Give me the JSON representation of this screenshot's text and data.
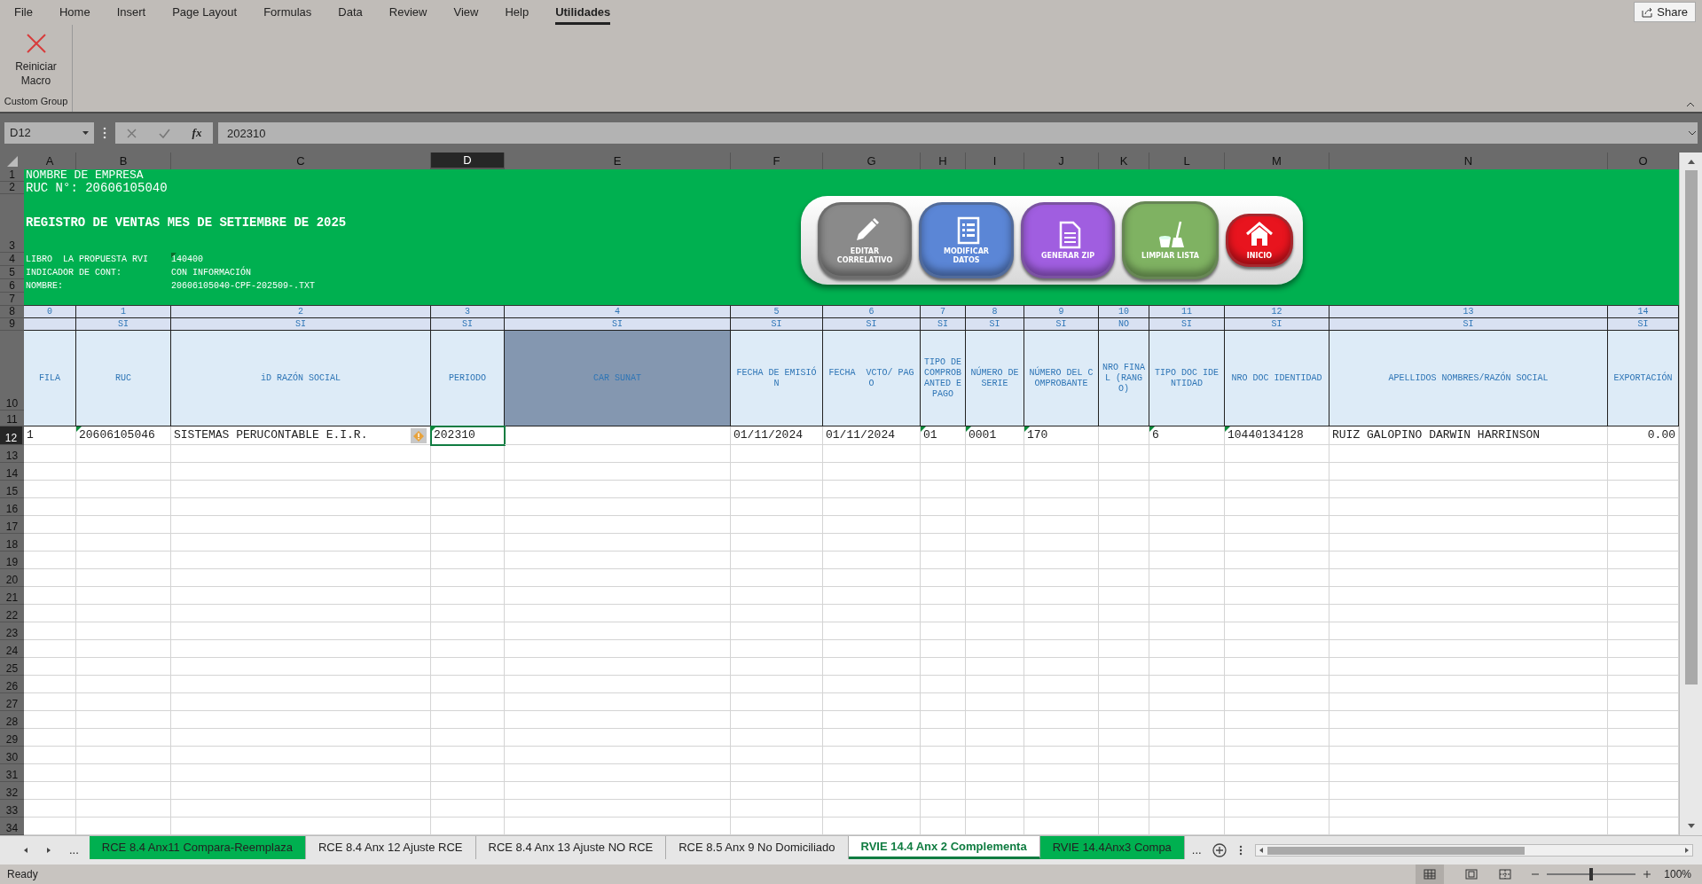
{
  "menu_tabs": [
    {
      "label": "File",
      "selected": false
    },
    {
      "label": "Home",
      "selected": false
    },
    {
      "label": "Insert",
      "selected": false
    },
    {
      "label": "Page Layout",
      "selected": false
    },
    {
      "label": "Formulas",
      "selected": false
    },
    {
      "label": "Data",
      "selected": false
    },
    {
      "label": "Review",
      "selected": false
    },
    {
      "label": "View",
      "selected": false
    },
    {
      "label": "Help",
      "selected": false
    },
    {
      "label": "Utilidades",
      "selected": true
    }
  ],
  "share_button": "Share",
  "ribbon": {
    "buttons": [
      {
        "label": "Reiniciar Macro"
      }
    ],
    "group_label": "Custom Group"
  },
  "formula_bar": {
    "name_box": "D12",
    "function_label": "fx",
    "value": "202310"
  },
  "column_headers": [
    {
      "label": "A",
      "selected": false
    },
    {
      "label": "B",
      "selected": false
    },
    {
      "label": "C",
      "selected": false
    },
    {
      "label": "D",
      "selected": true
    },
    {
      "label": "E",
      "selected": false
    },
    {
      "label": "F",
      "selected": false
    },
    {
      "label": "G",
      "selected": false
    },
    {
      "label": "H",
      "selected": false
    },
    {
      "label": "I",
      "selected": false
    },
    {
      "label": "J",
      "selected": false
    },
    {
      "label": "K",
      "selected": false
    },
    {
      "label": "L",
      "selected": false
    },
    {
      "label": "M",
      "selected": false
    },
    {
      "label": "N",
      "selected": false
    },
    {
      "label": "O",
      "selected": false
    }
  ],
  "row_numbers": [
    {
      "label": "1",
      "selected": false
    },
    {
      "label": "2",
      "selected": false
    },
    {
      "label": "3",
      "selected": false
    },
    {
      "label": "4",
      "selected": false
    },
    {
      "label": "5",
      "selected": false
    },
    {
      "label": "6",
      "selected": false
    },
    {
      "label": "7",
      "selected": false
    },
    {
      "label": "8",
      "selected": false
    },
    {
      "label": "9",
      "selected": false
    },
    {
      "label": "10",
      "selected": false
    },
    {
      "label": "11",
      "selected": false
    },
    {
      "label": "12",
      "selected": true
    },
    {
      "label": "13",
      "selected": false
    },
    {
      "label": "14",
      "selected": false
    },
    {
      "label": "15",
      "selected": false
    },
    {
      "label": "16",
      "selected": false
    },
    {
      "label": "17",
      "selected": false
    },
    {
      "label": "18",
      "selected": false
    },
    {
      "label": "19",
      "selected": false
    },
    {
      "label": "20",
      "selected": false
    },
    {
      "label": "21",
      "selected": false
    },
    {
      "label": "22",
      "selected": false
    },
    {
      "label": "23",
      "selected": false
    },
    {
      "label": "24",
      "selected": false
    },
    {
      "label": "25",
      "selected": false
    },
    {
      "label": "26",
      "selected": false
    },
    {
      "label": "27",
      "selected": false
    },
    {
      "label": "28",
      "selected": false
    },
    {
      "label": "29",
      "selected": false
    },
    {
      "label": "30",
      "selected": false
    },
    {
      "label": "31",
      "selected": false
    },
    {
      "label": "32",
      "selected": false
    },
    {
      "label": "33",
      "selected": false
    },
    {
      "label": "34",
      "selected": false
    }
  ],
  "header_block": {
    "company": "NOMBRE DE EMPRESA",
    "ruc": "RUC N°: 20606105040",
    "title": "REGISTRO DE VENTAS MES DE SETIEMBRE DE 2025",
    "info": [
      {
        "label": "LIBRO  LA PROPUESTA RVI",
        "value": "140400",
        "error_indicator": true
      },
      {
        "label": "INDICADOR DE CONT:",
        "value": "CON INFORMACIÓN",
        "error_indicator": false
      },
      {
        "label": "NOMBRE:",
        "value": "20606105040-CPF-202509-.TXT",
        "error_indicator": false
      }
    ]
  },
  "action_buttons": [
    {
      "label": "EDITAR CORRELATIVO",
      "kind": "pencil",
      "color": "#8a8a8a"
    },
    {
      "label": "MODIFICAR DATOS",
      "kind": "list",
      "color": "#5b86d6"
    },
    {
      "label": "GENERAR ZIP",
      "kind": "document",
      "color": "#a05ee0"
    },
    {
      "label": "LIMPIAR LISTA",
      "kind": "broom",
      "color": "#7fb262"
    },
    {
      "label": "INICIO",
      "kind": "home",
      "color": "#e8141e"
    }
  ],
  "columns": [
    {
      "number": "0",
      "header": "FILA",
      "value": "1",
      "kind": "text",
      "error_indicator": false,
      "shaded": false,
      "selected": false
    },
    {
      "number": "1",
      "flag": "SI",
      "header": "RUC",
      "value": "20606105046",
      "kind": "text",
      "error_indicator": true,
      "shaded": false,
      "selected": false
    },
    {
      "number": "2",
      "flag": "SI",
      "header": "iD RAZÓN SOCIAL",
      "value": "SISTEMAS PERUCONTABLE E.I.R.",
      "kind": "text",
      "error_indicator": false,
      "warning": true,
      "shaded": false,
      "selected": false
    },
    {
      "number": "3",
      "flag": "SI",
      "header": "PERIODO",
      "value": "202310",
      "kind": "text",
      "error_indicator": true,
      "shaded": false,
      "selected": true
    },
    {
      "number": "4",
      "flag": "SI",
      "header": "CAR SUNAT",
      "kind": "text",
      "error_indicator": false,
      "shaded": true,
      "selected": false
    },
    {
      "number": "5",
      "flag": "SI",
      "header": "FECHA DE EMISIÓN",
      "value": "01/11/2024",
      "kind": "text",
      "error_indicator": false,
      "shaded": false,
      "selected": false
    },
    {
      "number": "6",
      "flag": "SI",
      "header": "FECHA  VCTO/ PAGO",
      "value": "01/11/2024",
      "kind": "text",
      "error_indicator": false,
      "shaded": false,
      "selected": false
    },
    {
      "number": "7",
      "flag": "SI",
      "header": "TIPO DE COMPROBANTED E PAGO",
      "value": "01",
      "kind": "text",
      "error_indicator": true,
      "shaded": false,
      "selected": false
    },
    {
      "number": "8",
      "flag": "SI",
      "header": "NÚMERO DE SERIE",
      "value": "0001",
      "kind": "text",
      "error_indicator": true,
      "shaded": false,
      "selected": false
    },
    {
      "number": "9",
      "flag": "SI",
      "header": "NÚMERO DEL COMPROBANTE",
      "value": "170",
      "kind": "text",
      "error_indicator": true,
      "shaded": false,
      "selected": false
    },
    {
      "number": "10",
      "flag": "NO",
      "header": "NRO FINAL (RANGO)",
      "kind": "text",
      "error_indicator": false,
      "shaded": false,
      "selected": false
    },
    {
      "number": "11",
      "flag": "SI",
      "header": "TIPO DOC IDENTIDAD",
      "value": "6",
      "kind": "text",
      "error_indicator": true,
      "shaded": false,
      "selected": false
    },
    {
      "number": "12",
      "flag": "SI",
      "header": "NRO DOC IDENTIDAD",
      "value": "10440134128",
      "kind": "text",
      "error_indicator": true,
      "shaded": false,
      "selected": false
    },
    {
      "number": "13",
      "flag": "SI",
      "header": "APELLIDOS NOMBRES/RAZÓN SOCIAL",
      "value": "RUIZ GALOPINO DARWIN HARRINSON",
      "kind": "text",
      "error_indicator": false,
      "shaded": false,
      "selected": false
    },
    {
      "number": "14",
      "flag": "SI",
      "header": "EXPORTACIÓN",
      "value": "0.00",
      "kind": "amount",
      "error_indicator": false,
      "shaded": false,
      "selected": false
    }
  ],
  "sheet_tabs": [
    {
      "label": "RCE 8.4 Anx11 Compara-Reemplaza",
      "selected": false,
      "color": "#00b050"
    },
    {
      "label": "RCE 8.4 Anx 12 Ajuste RCE",
      "selected": false
    },
    {
      "label": "RCE 8.4 Anx 13 Ajuste NO RCE",
      "selected": false
    },
    {
      "label": "RCE 8.5 Anx 9 No Domiciliado",
      "selected": false
    },
    {
      "label": "RVIE 14.4 Anx 2 Complementa",
      "selected": true
    },
    {
      "label": "RVIE 14.4Anx3 Compa",
      "selected": false,
      "color": "#00b050"
    }
  ],
  "tab_overflow_left": "...",
  "tab_overflow_right": "...",
  "status_bar": {
    "status": "Ready",
    "zoom_slider": {
      "level": 0.5
    },
    "zoom": "100%"
  }
}
